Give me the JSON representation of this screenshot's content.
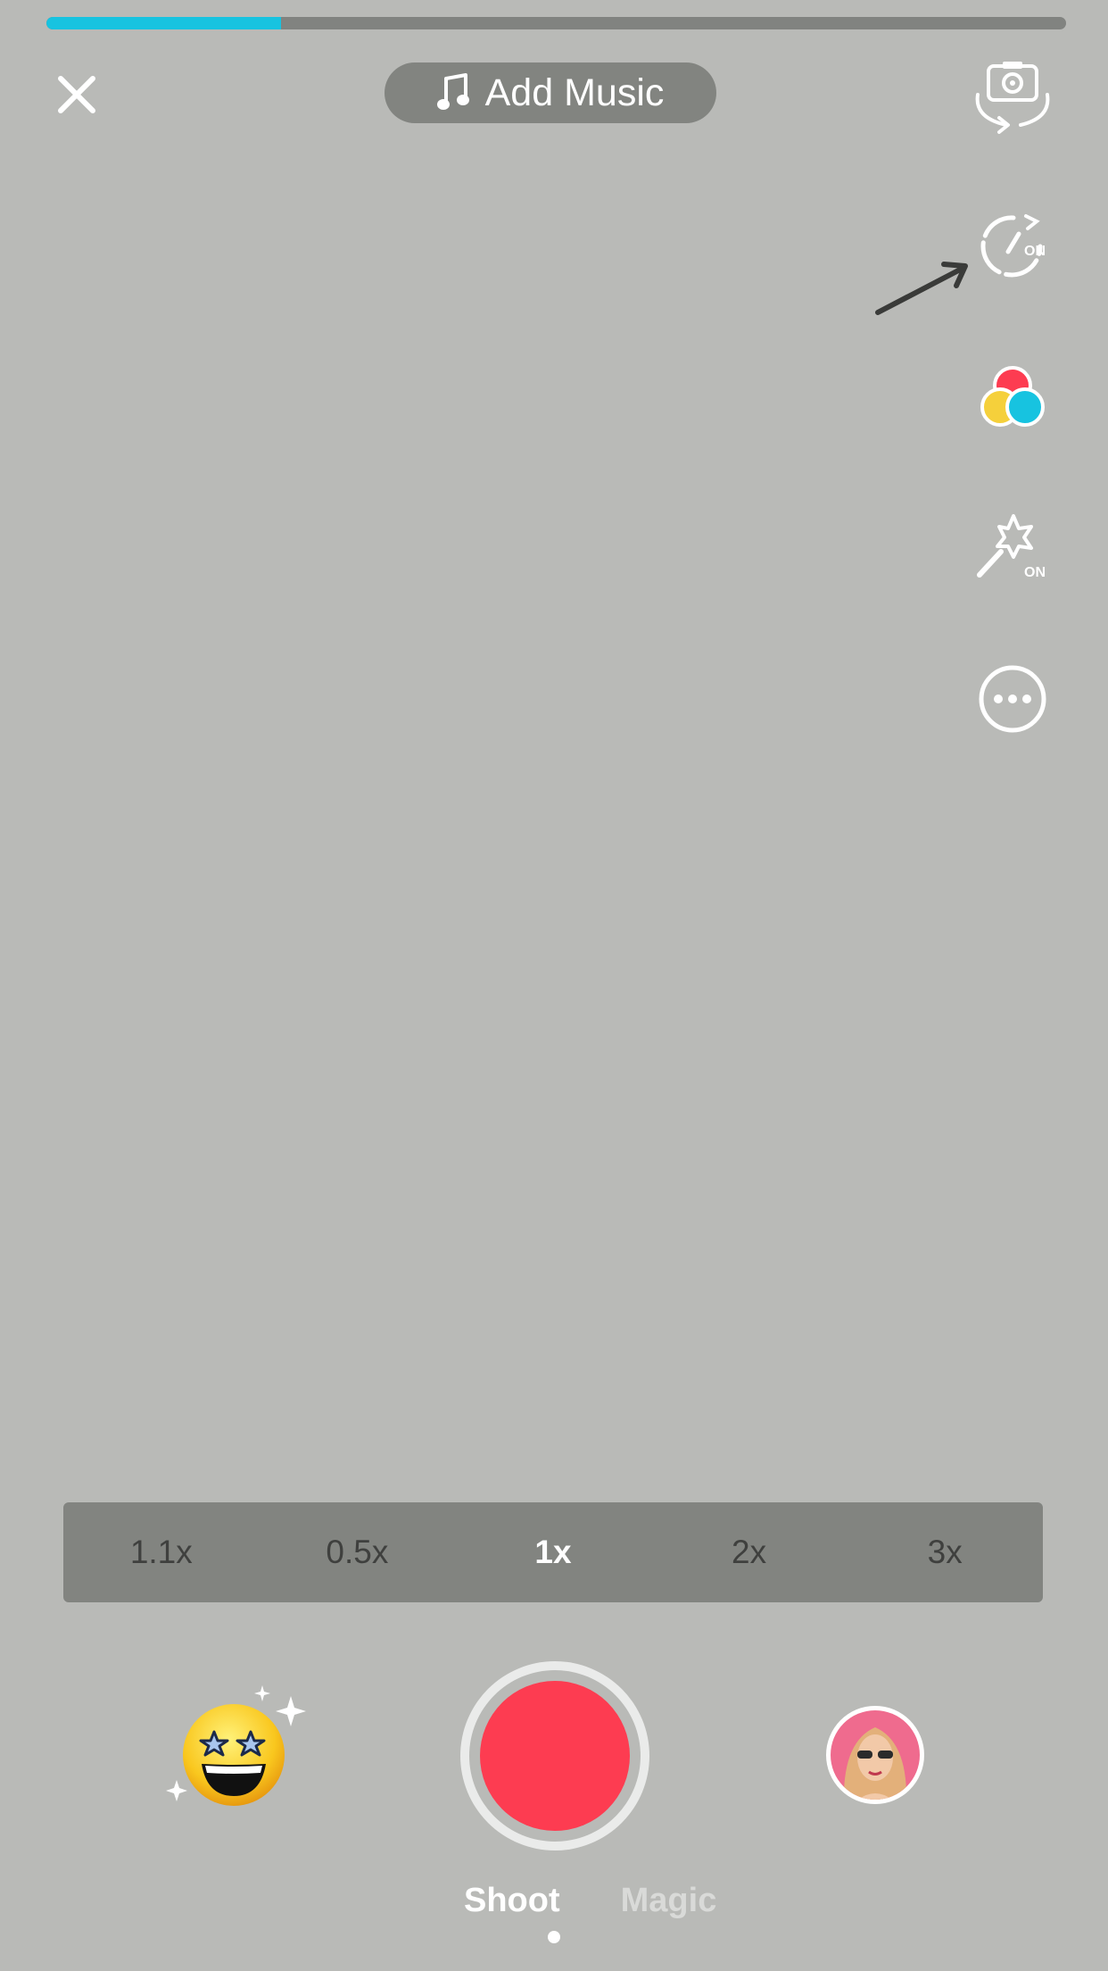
{
  "recording": {
    "progress_fraction": 0.23,
    "accent_color": "#17c3e0",
    "record_color": "#fd3c51"
  },
  "top_bar": {
    "close_icon": "close-icon",
    "music_label": "Add Music",
    "music_icon": "music-note-icon",
    "flip_icon": "flip-camera-icon"
  },
  "side_tools": [
    {
      "name": "speed-timer",
      "icon": "speedometer-icon",
      "badge": "ON"
    },
    {
      "name": "filters",
      "icon": "color-filter-icon"
    },
    {
      "name": "beauty",
      "icon": "magic-wand-icon",
      "badge": "ON"
    },
    {
      "name": "more",
      "icon": "more-options-icon"
    }
  ],
  "speed_options": [
    "1.1x",
    "0.5x",
    "1x",
    "2x",
    "3x"
  ],
  "speed_selected": "1x",
  "bottom": {
    "sticker_icon": "star-eyes-emoji-icon",
    "avatar_icon": "user-avatar-icon"
  },
  "mode_tabs": {
    "shoot": "Shoot",
    "magic": "Magic",
    "selected": "Shoot"
  }
}
